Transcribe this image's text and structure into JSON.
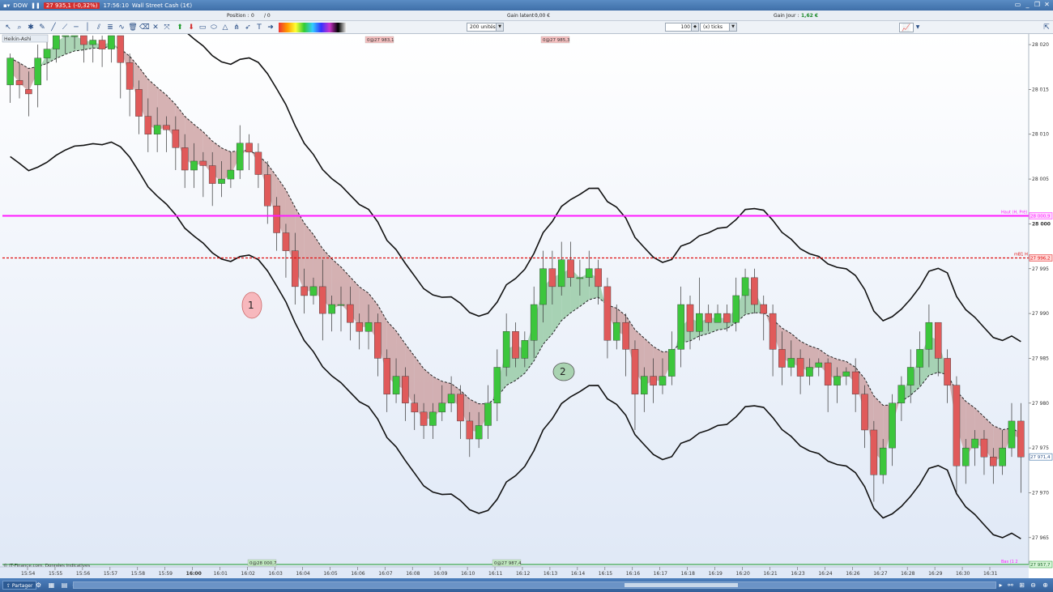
{
  "titlebar": {
    "menu": "DOW",
    "price": "27 935,1 (-0,32%)",
    "time": "17:56:10",
    "instrument": "Wall Street Cash (1€)"
  },
  "infobar": {
    "position_label": "Position :",
    "position_value": "0",
    "position_sep": "/ 0",
    "gain_latent_label": "Gain latent :",
    "gain_latent_value": "0,00 €",
    "gain_jour_label": "Gain Jour :",
    "gain_jour_value": "1,62 €"
  },
  "toolbar": {
    "units_select": "200 unités",
    "ticks_value": "100",
    "ticks_select": "(x) ticks"
  },
  "chart": {
    "indicator_label": "Heikin-Ashi",
    "copyright": "© IT-Finance.com. Données indicatives",
    "order_labels": [
      "0@27 983,1",
      "0@27 985,3",
      "0@28 000,7",
      "0@27 987,4"
    ],
    "line_labels": {
      "magenta": "Haut (H, Pré)",
      "magenta_value": "28 000,9",
      "red": "mB1 H",
      "red_value": "27 996,2",
      "last_price": "27 971,4",
      "bottom_value": "27 957,7",
      "bottom_tag": "Bas (1 2"
    },
    "annotations": [
      "1",
      "2"
    ],
    "colors": {
      "bull": "#3cc63c",
      "bear": "#e05a5a",
      "fill_bear": "#c99a9a",
      "fill_bull": "#8fc79c",
      "magenta": "#ff1aff",
      "red": "#e01010"
    }
  },
  "chart_data": {
    "type": "candlestick",
    "y_ticks": [
      "28 020",
      "28 015",
      "28 010",
      "28 005",
      "28 000",
      "27 995",
      "27 990",
      "27 985",
      "27 980",
      "27 975",
      "27 970",
      "27 965"
    ],
    "x_ticks": [
      "15:54",
      "15:55",
      "15:56",
      "15:57",
      "15:58",
      "15:59",
      "16:00",
      "16:01",
      "16:02",
      "16:03",
      "16:04",
      "16:05",
      "16:06",
      "16:07",
      "16:08",
      "16:09",
      "16:10",
      "16:11",
      "16:12",
      "16:13",
      "16:14",
      "16:15",
      "16:16",
      "16:17",
      "16:18",
      "16:19",
      "16:20",
      "16:21",
      "16:23",
      "16:24",
      "16:26",
      "16:27",
      "16:28",
      "16:29",
      "16:30",
      "16:31"
    ],
    "ylim": [
      27962,
      28021
    ],
    "levels": {
      "magenta": 28000.9,
      "red_dashed": 27996.2
    },
    "candles": [
      [
        28015.5,
        28018.5,
        28019,
        28013.5
      ],
      [
        28016,
        28015.5,
        28018,
        28014
      ],
      [
        28015,
        28014.5,
        28017,
        28012
      ],
      [
        28015.5,
        28018.5,
        28020,
        28013
      ],
      [
        28018.5,
        28019.5,
        28021,
        28016
      ],
      [
        28019.5,
        28021,
        28021,
        28018
      ],
      [
        28021,
        28021,
        28021,
        28019
      ],
      [
        28021,
        28021,
        28021,
        28019.5
      ],
      [
        28021,
        28020,
        28021,
        28018
      ],
      [
        28020,
        28020.5,
        28021,
        28018
      ],
      [
        28020.5,
        28019.5,
        28021,
        28017.5
      ],
      [
        28019.5,
        28021,
        28021,
        28018
      ],
      [
        28021,
        28018,
        28021,
        28014
      ],
      [
        28018,
        28015,
        28019,
        28012
      ],
      [
        28015,
        28012,
        28016,
        28010
      ],
      [
        28012,
        28010,
        28014,
        28008
      ],
      [
        28010,
        28011,
        28013,
        28008
      ],
      [
        28011,
        28010.5,
        28012,
        28008
      ],
      [
        28010.5,
        28008.5,
        28012,
        28006
      ],
      [
        28008.5,
        28006,
        28010,
        28004
      ],
      [
        28006,
        28007,
        28009,
        28004
      ],
      [
        28007,
        28006.5,
        28008,
        28003
      ],
      [
        28006.5,
        28004.5,
        28008,
        28002
      ],
      [
        28004.5,
        28005,
        28007,
        28003
      ],
      [
        28005,
        28006,
        28008,
        28004
      ],
      [
        28006,
        28009,
        28011,
        28005
      ],
      [
        28009,
        28008,
        28010,
        28006
      ],
      [
        28008,
        28005.5,
        28009,
        28004
      ],
      [
        28005.5,
        28002,
        28007,
        28000
      ],
      [
        28002,
        27999,
        28003,
        27997
      ],
      [
        27999,
        27997,
        28000,
        27994
      ],
      [
        27997,
        27993,
        27999,
        27991
      ],
      [
        27993,
        27992,
        27995,
        27990
      ],
      [
        27992,
        27993,
        27994,
        27991
      ],
      [
        27993,
        27990,
        27996,
        27987
      ],
      [
        27990,
        27991,
        27992,
        27988
      ],
      [
        27991,
        27991,
        27993,
        27988
      ],
      [
        27991,
        27989,
        27993,
        27987
      ],
      [
        27989,
        27988,
        27990,
        27986
      ],
      [
        27988,
        27989,
        27991,
        27986
      ],
      [
        27989,
        27985,
        27990,
        27983
      ],
      [
        27985,
        27981,
        27986,
        27979
      ],
      [
        27981,
        27983,
        27985,
        27980
      ],
      [
        27983,
        27980,
        27984,
        27978
      ],
      [
        27980,
        27979,
        27981,
        27977
      ],
      [
        27979,
        27977.5,
        27980,
        27976
      ],
      [
        27977.5,
        27979,
        27980,
        27976
      ],
      [
        27979,
        27980,
        27982,
        27978
      ],
      [
        27980,
        27981,
        27983,
        27979
      ],
      [
        27981,
        27978,
        27982,
        27976
      ],
      [
        27978,
        27976,
        27979,
        27974
      ],
      [
        27976,
        27977.5,
        27979,
        27975
      ],
      [
        27977.5,
        27980,
        27982,
        27976
      ],
      [
        27980,
        27984,
        27986,
        27978
      ],
      [
        27984,
        27988,
        27990,
        27983
      ],
      [
        27988,
        27985,
        27989,
        27984
      ],
      [
        27985,
        27987,
        27988,
        27984
      ],
      [
        27987,
        27991,
        27993,
        27985
      ],
      [
        27991,
        27995,
        27997,
        27989
      ],
      [
        27995,
        27993,
        27997,
        27991
      ],
      [
        27993,
        27996,
        27998,
        27992
      ],
      [
        27996,
        27994,
        27998,
        27993
      ],
      [
        27994,
        27994,
        27996,
        27992
      ],
      [
        27994,
        27995,
        27997,
        27993
      ],
      [
        27995,
        27993,
        27996,
        27991
      ],
      [
        27993,
        27987,
        27994,
        27985
      ],
      [
        27987,
        27989,
        27991,
        27986
      ],
      [
        27989,
        27986,
        27990,
        27983
      ],
      [
        27986,
        27981,
        27987,
        27977
      ],
      [
        27981,
        27983,
        27984,
        27979
      ],
      [
        27983,
        27982,
        27985,
        27980
      ],
      [
        27982,
        27983,
        27985,
        27981
      ],
      [
        27983,
        27986,
        27988,
        27982
      ],
      [
        27986,
        27991,
        27993,
        27984
      ],
      [
        27991,
        27988,
        27992,
        27986
      ],
      [
        27988,
        27990,
        27994,
        27987
      ],
      [
        27990,
        27989,
        27991,
        27988
      ],
      [
        27989,
        27990,
        27991,
        27989
      ],
      [
        27990,
        27989,
        27991,
        27988
      ],
      [
        27989,
        27992,
        27994,
        27988
      ],
      [
        27992,
        27994,
        27995,
        27990
      ],
      [
        27994,
        27991,
        27995,
        27990
      ],
      [
        27991,
        27990,
        27992,
        27987
      ],
      [
        27990,
        27986,
        27991,
        27983
      ],
      [
        27986,
        27984,
        27988,
        27982
      ],
      [
        27984,
        27985,
        27987,
        27983
      ],
      [
        27985,
        27983,
        27986,
        27981
      ],
      [
        27983,
        27984,
        27985,
        27982
      ],
      [
        27984,
        27984.5,
        27985,
        27983
      ],
      [
        27984.5,
        27982,
        27985,
        27979
      ],
      [
        27982,
        27983,
        27984,
        27980
      ],
      [
        27983,
        27983.5,
        27984,
        27982
      ],
      [
        27983.5,
        27981,
        27985,
        27979
      ],
      [
        27981,
        27977,
        27982,
        27975
      ],
      [
        27977,
        27972,
        27978,
        27969
      ],
      [
        27972,
        27975,
        27976,
        27971
      ],
      [
        27975,
        27980,
        27981,
        27973
      ],
      [
        27980,
        27982,
        27983,
        27978
      ],
      [
        27982,
        27984,
        27986,
        27980
      ],
      [
        27984,
        27986,
        27988,
        27982
      ],
      [
        27986,
        27989,
        27991,
        27984
      ],
      [
        27989,
        27985,
        27989,
        27983
      ],
      [
        27985,
        27982,
        27986,
        27980
      ],
      [
        27982,
        27973,
        27983,
        27970
      ],
      [
        27973,
        27975,
        27976,
        27971
      ],
      [
        27975,
        27976,
        27977,
        27973
      ],
      [
        27976,
        27974,
        27977,
        27972
      ],
      [
        27974,
        27973,
        27975,
        27971
      ],
      [
        27973,
        27975,
        27977,
        27972
      ],
      [
        27975,
        27978,
        27980,
        27974
      ],
      [
        27978,
        27974,
        27980,
        27970
      ]
    ]
  }
}
